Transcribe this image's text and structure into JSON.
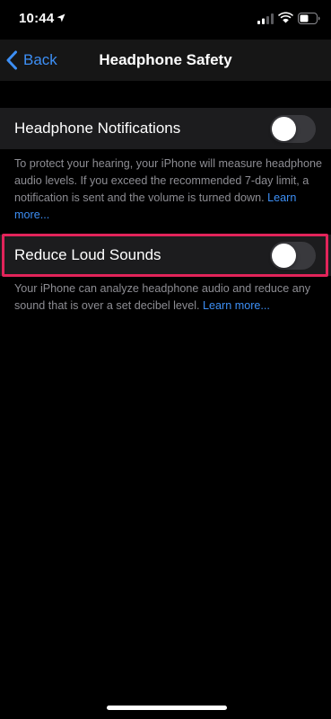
{
  "status_bar": {
    "time": "10:44",
    "icons": [
      "location-arrow-icon",
      "cellular-signal-icon",
      "wifi-icon",
      "battery-icon"
    ]
  },
  "nav": {
    "back_label": "Back",
    "title": "Headphone Safety"
  },
  "settings": [
    {
      "label": "Headphone Notifications",
      "enabled": false,
      "footer": "To protect your hearing, your iPhone will measure headphone audio levels. If you exceed the recommended 7-day limit, a notification is sent and the volume is turned down.",
      "footer_link": "Learn more..."
    },
    {
      "label": "Reduce Loud Sounds",
      "enabled": false,
      "footer": "Your iPhone can analyze headphone audio and reduce any sound that is over a set decibel level.",
      "footer_link": "Learn more..."
    }
  ],
  "colors": {
    "background": "#000000",
    "cell": "#1c1c1e",
    "accent": "#3d8ff5",
    "footer_text": "#8d8d93",
    "toggle_off": "#39393d",
    "highlight": "#e2245a"
  }
}
